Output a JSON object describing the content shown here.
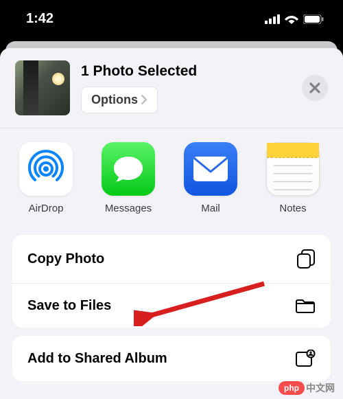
{
  "status": {
    "time": "1:42"
  },
  "header": {
    "title": "1 Photo Selected",
    "options_label": "Options"
  },
  "share_targets": [
    {
      "label": "AirDrop"
    },
    {
      "label": "Messages"
    },
    {
      "label": "Mail"
    },
    {
      "label": "Notes"
    }
  ],
  "actions_group1": [
    {
      "label": "Copy Photo"
    },
    {
      "label": "Save to Files"
    }
  ],
  "actions_group2": [
    {
      "label": "Add to Shared Album"
    }
  ],
  "watermark": {
    "badge": "php",
    "text": "中文网"
  }
}
